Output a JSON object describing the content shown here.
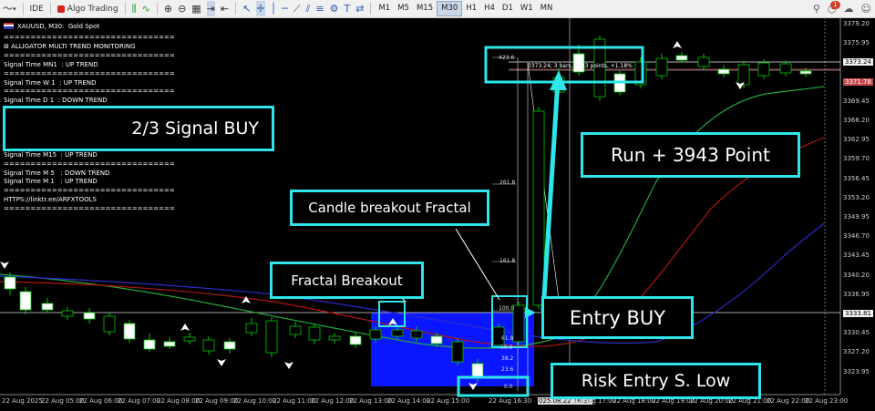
{
  "toolbar": {
    "ide_label": "IDE",
    "algo_label": "Algo Trading",
    "timeframes": [
      "M1",
      "M5",
      "M15",
      "M30",
      "H1",
      "H4",
      "D1",
      "W1",
      "MN"
    ],
    "active_timeframe": "M30",
    "notif_count": "1"
  },
  "chart": {
    "symbol_title": "XAUUSD, M30:  Gold Spot",
    "info_lines": [
      "================================",
      "⊞ ALLIGATOR MULTI TREND MONITORING",
      "================================",
      "Signal Time MN1  : UP TREND",
      "================================",
      "Signal Time W 1  : UP TREND",
      "================================",
      "Signal Time D 1  : DOWN TREND",
      "Signal Time H 4  : DOWN TREND",
      "================================",
      "Signal Time H 1    : UP TREND",
      "Signal Time M30   : UP TREND",
      "================================",
      "Signal Time M15  : UP TREND",
      "================================",
      "Signal Time M 5   : DOWN TREND",
      "Signal Time M 1   : UP TREND",
      "================================",
      "HTTPS://linktr.ee/ARFXTOOLS",
      "================================"
    ],
    "price_scale": [
      "3379.20",
      "3375.95",
      "3373.24",
      "3371.78",
      "3369.45",
      "3366.20",
      "3362.95",
      "3359.70",
      "3356.45",
      "3353.20",
      "3349.95",
      "3346.70",
      "3343.45",
      "3340.20",
      "3336.95",
      "3333.81",
      "3330.45",
      "3327.20",
      "3323.95"
    ],
    "time_scale": [
      "22 Aug 2025",
      "22 Aug 05:00",
      "22 Aug 06:00",
      "22 Aug 07:00",
      "22 Aug 08:00",
      "22 Aug 09:00",
      "22 Aug 10:00",
      "22 Aug 11:00",
      "22 Aug 12:00",
      "22 Aug 13:00",
      "22 Aug 14:00",
      "22 Aug 15:00",
      "22 Aug 16:30",
      "025.08.22 16:30",
      "22 Aug 17:00",
      "22 Aug 18:00",
      "22 Aug 19:00",
      "22 Aug 20:00",
      "22 Aug 21:00",
      "22 Aug 22:00",
      "22 Aug 23:00"
    ],
    "fib_levels": [
      "423.6",
      "261.8",
      "161.8",
      "100.0",
      "61.8",
      "50.0",
      "38.2",
      "23.6",
      "0.0"
    ],
    "measure_text": "3373.24; 3 bars, 3943 points, +1.18%"
  },
  "annotations": {
    "signal_buy": "2/3 Signal BUY",
    "run_points": "Run + 3943 Point",
    "candle_breakout": "Candle breakout Fractal",
    "fractal_breakout": "Fractal Breakout",
    "entry_buy": "Entry BUY",
    "risk_entry": "Risk Entry S. Low"
  },
  "colors": {
    "bull_candle": "#ffffff",
    "bear_candle": "#000000",
    "candle_outline": "#00c800",
    "annotation_border": "#2ee6ea",
    "zone_fill": "#0a16ff",
    "ma_green": "#22a53a",
    "ma_red": "#b01515",
    "ma_blue": "#2a2cc8"
  }
}
